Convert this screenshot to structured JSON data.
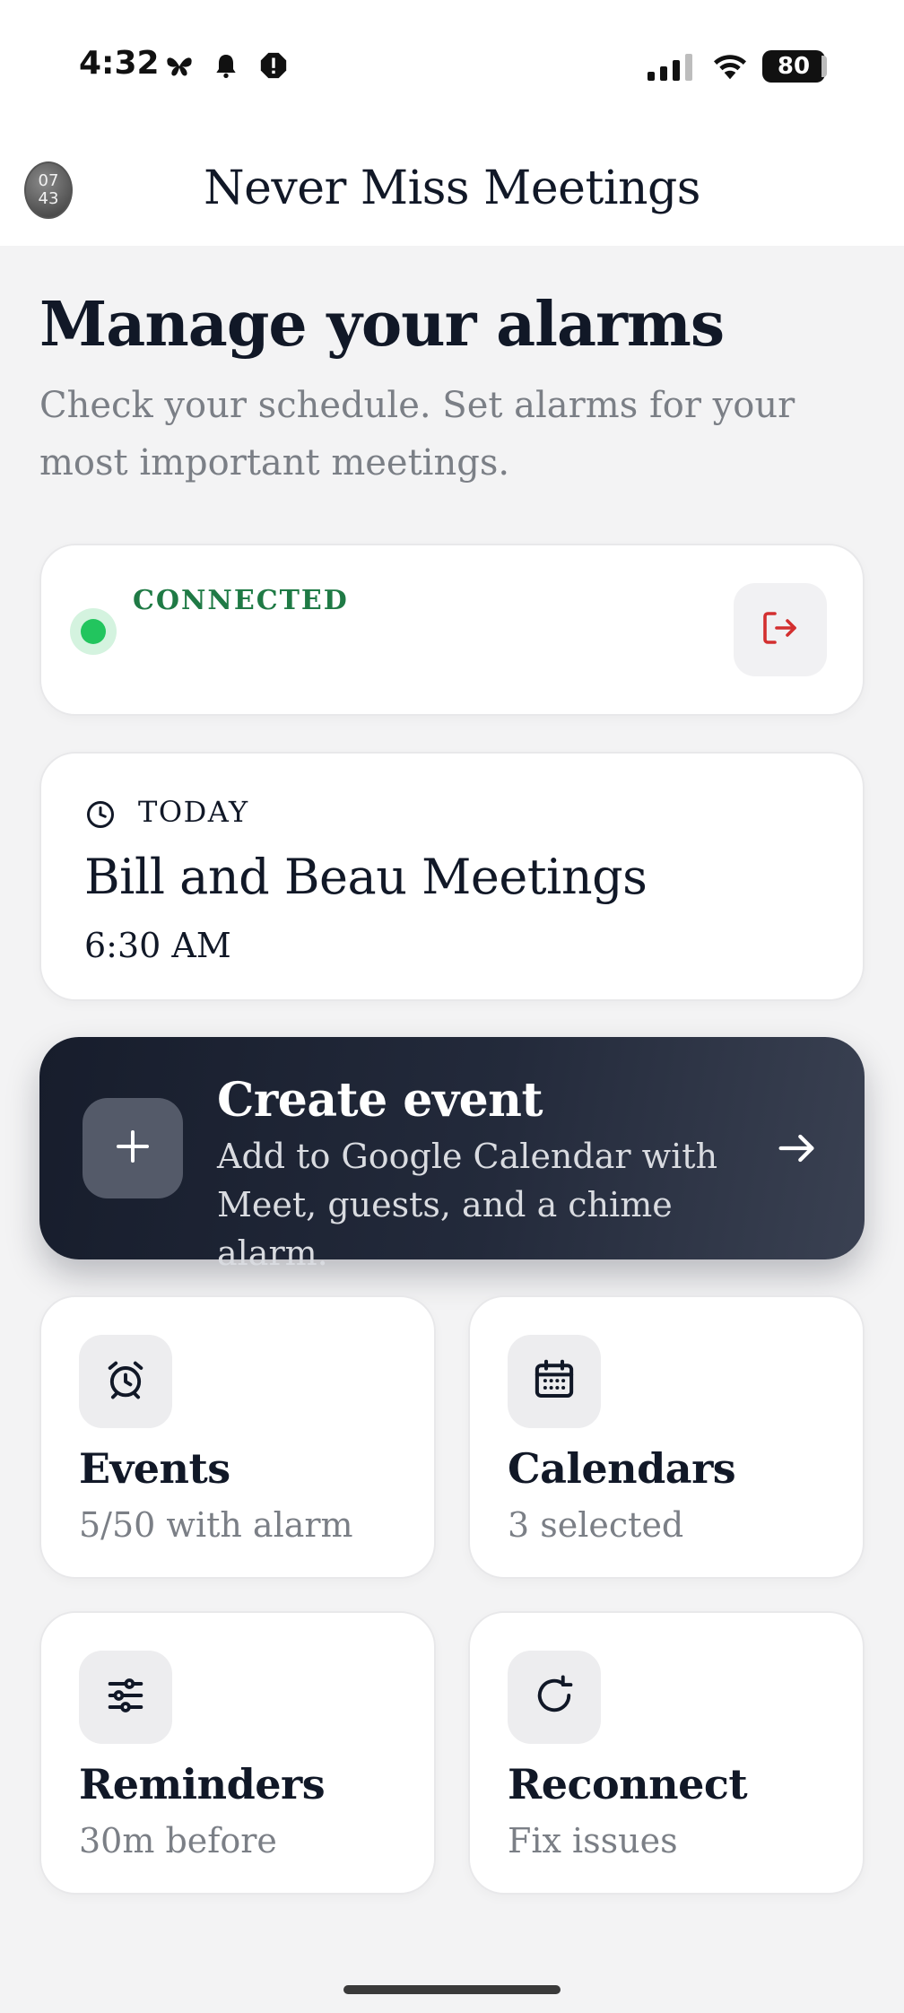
{
  "status_bar": {
    "time": "4:32",
    "battery": "80",
    "icons": [
      "butterfly-icon",
      "bell-icon",
      "alert-icon",
      "signal-icon",
      "wifi-icon",
      "battery-icon"
    ]
  },
  "app_bar": {
    "title": "Never Miss Meetings",
    "avatar_text": "07\n43"
  },
  "header": {
    "title": "Manage your alarms",
    "subtitle": "Check your schedule. Set alarms for your most important meetings."
  },
  "connection": {
    "status": "CONNECTED",
    "status_color": "#1f7a45",
    "dot_color": "#22c55e",
    "action_icon": "logout-icon"
  },
  "today": {
    "label": "TODAY",
    "meeting_title": "Bill and Beau Meetings",
    "meeting_time": "6:30 AM"
  },
  "create_event": {
    "title": "Create event",
    "subtitle": "Add to Google Calendar with Meet, guests, and a chime alarm."
  },
  "tiles": [
    {
      "title": "Events",
      "subtitle": "5/50 with alarm",
      "icon": "alarm-clock-icon"
    },
    {
      "title": "Calendars",
      "subtitle": "3 selected",
      "icon": "calendar-icon"
    },
    {
      "title": "Reminders",
      "subtitle": "30m before",
      "icon": "sliders-icon"
    },
    {
      "title": "Reconnect",
      "subtitle": "Fix issues",
      "icon": "refresh-icon"
    }
  ]
}
